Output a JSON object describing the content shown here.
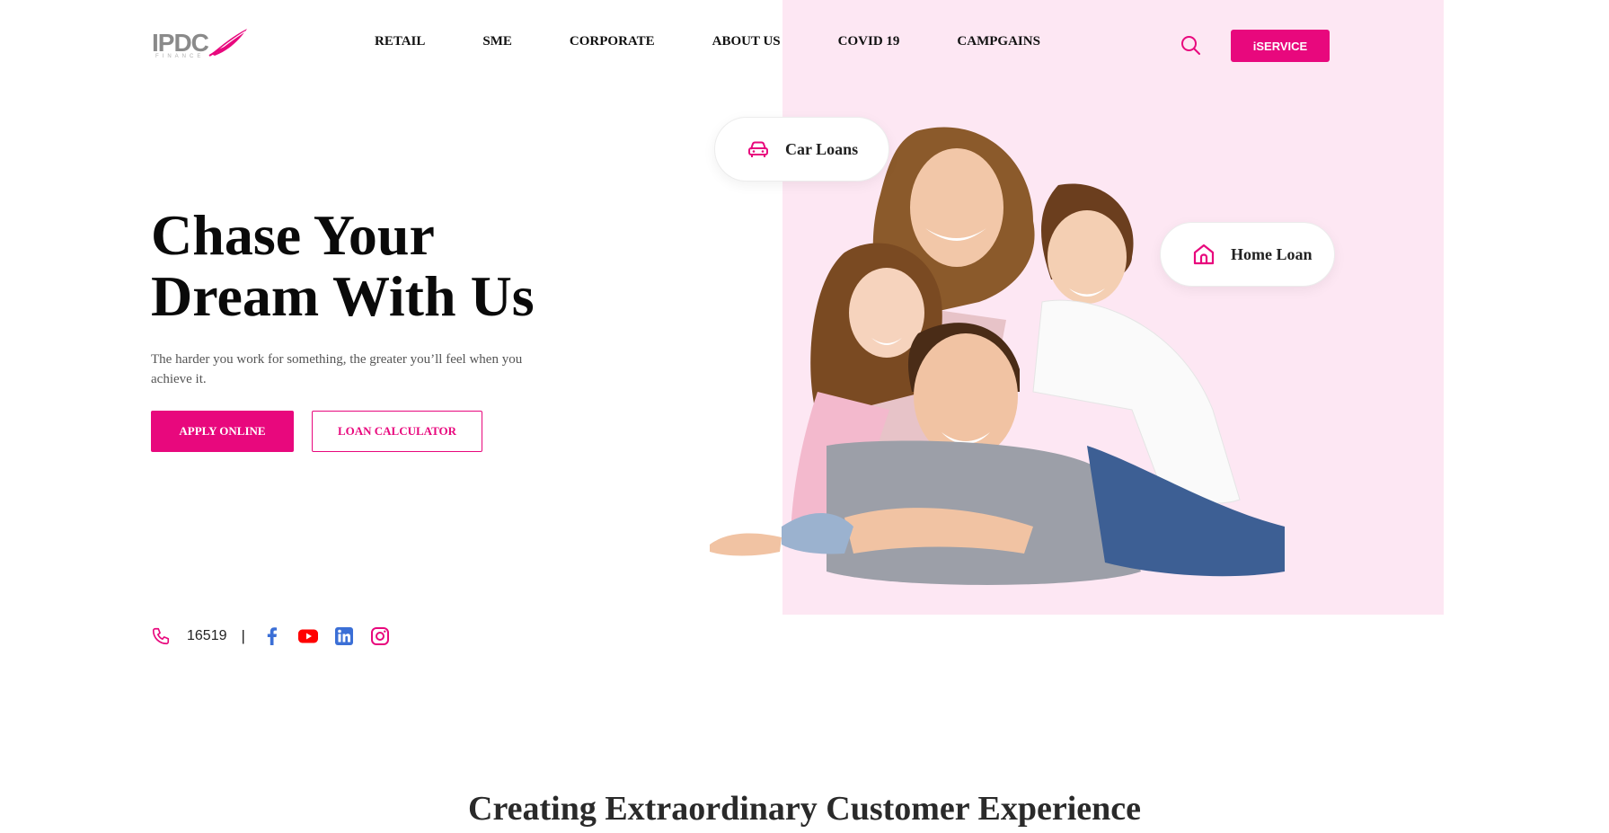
{
  "brand": {
    "logo_text": "IPDC",
    "logo_sub": "FINANCE",
    "accent": "#e8087d",
    "panel_color": "#fde7f3"
  },
  "header": {
    "nav": [
      "RETAIL",
      "SME",
      "CORPORATE",
      "ABOUT US",
      "COVID 19",
      "CAMPGAINS"
    ],
    "search_icon": "search-icon",
    "iservice_label": "iSERVICE"
  },
  "hero": {
    "title_line1": "Chase Your",
    "title_line2": "Dream With Us",
    "subtitle": "The harder you work for something, the greater you’ll feel when you achieve it.",
    "apply_label": "APPLY ONLINE",
    "calculator_label": "LOAN CALCULATOR"
  },
  "contact": {
    "phone": "16519",
    "separator": "|",
    "social": [
      "facebook-icon",
      "youtube-icon",
      "linkedin-icon",
      "instagram-icon"
    ]
  },
  "pills": {
    "car": "Car Loans",
    "home": "Home Loan"
  },
  "section": {
    "title": "Creating Extraordinary Customer Experience"
  }
}
